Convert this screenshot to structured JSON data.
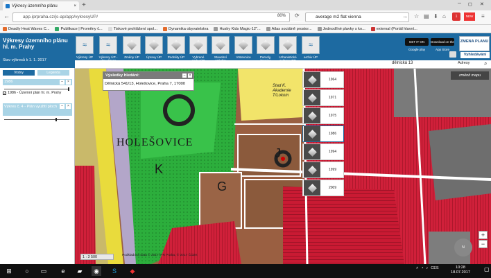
{
  "browser": {
    "tab_title": "Výkresy územního plánu",
    "tab_close": "×",
    "new_tab": "+",
    "url": "app.iprpraha.cz/js-ap/app/vykresyUP/",
    "zoom": "80%",
    "search_query": "average m2 flat vienna",
    "badge_red": "1",
    "badge_new": "NEW"
  },
  "bookmarks": [
    "Deadly Heat Waves C...",
    "Publikace | Proměny č...",
    "Tiskové prohlášení spol...",
    "Dynamika obyvatelstva",
    "Husky Kids Magic-12\"...",
    "Atlas sociálně prostor...",
    "Jednodílné plavky s ko...",
    "external (Portál hlavní..."
  ],
  "app": {
    "title": "Výkresy územního plánu hl. m. Prahy",
    "subtitle": "Stav výkresů k 1. 1. 2017",
    "tools": [
      {
        "label": "Výkresy ÚP"
      },
      {
        "label": "Výkresy ÚP - aktualizace"
      },
      {
        "label": "Změny ÚP"
      },
      {
        "label": "Úpravy ÚP"
      },
      {
        "label": "Podněty ÚP"
      },
      {
        "label": "Vybrané prvky ÚP"
      },
      {
        "label": "Stavební uzávěry"
      },
      {
        "label": "Vrstevnice"
      },
      {
        "label": "Parcely, hranice"
      },
      {
        "label": "Urbanistické sektory IPR Praha"
      },
      {
        "label": "archiv ÚP"
      }
    ],
    "google_play": "GET IT ON Google play",
    "app_store": "Download on the App Store",
    "zmena_planu": "ZMENA PLANU",
    "vyhledavani": "Vyhledávání",
    "address_value": "dělnická 13",
    "adresy": "Adresy"
  },
  "left_panel": {
    "tab_vrstvy": "Vrstvy",
    "tab_legenda": "Legenda",
    "group1_title": "1986",
    "group1_item": "1986 - Územní plán hl. m. Prahy",
    "group2_title": "Výkres č. 4 - Plán využití ploch",
    "minus": "–",
    "close": "×",
    "check": "✓"
  },
  "popup": {
    "title": "Výsledky hledání:",
    "result": "Dělnická 541/13, Holešovice, Praha 7, 17000"
  },
  "years": [
    "1964",
    "1971",
    "1975",
    "1986",
    "1994",
    "1999",
    "2009"
  ],
  "map": {
    "zmenit_mapu": "změnit mapu",
    "scale": "1 : 3 500",
    "copyright": "Podkladová data © 2017 IPR Praha, © 2017 ČÚZK",
    "labels": {
      "holesovice": "HOLEŠOVICE",
      "K": "K",
      "J": "J",
      "G": "G",
      "stad": "Stad K. Akademie T/Lokom"
    },
    "zoom_in": "+",
    "zoom_out": "−",
    "compass": "N"
  },
  "taskbar": {
    "time": "10:28",
    "date": "18.07.2017",
    "lang": "CES"
  }
}
